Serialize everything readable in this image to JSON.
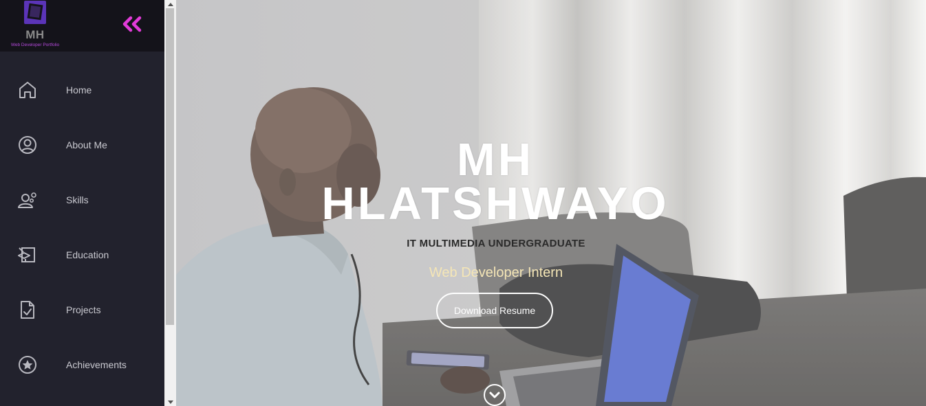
{
  "brand": {
    "initials": "MH",
    "tagline": "Web Developer Portfolio",
    "accent_color": "#e23bd9",
    "logo_color": "#6a3fd0"
  },
  "sidebar": {
    "collapse_icon": "double-chevron-left-icon",
    "items": [
      {
        "label": "Home",
        "icon": "home-icon"
      },
      {
        "label": "About Me",
        "icon": "user-circle-icon"
      },
      {
        "label": "Skills",
        "icon": "user-gear-icon"
      },
      {
        "label": "Education",
        "icon": "graduation-board-icon"
      },
      {
        "label": "Projects",
        "icon": "document-check-icon"
      },
      {
        "label": "Achievements",
        "icon": "star-circle-icon"
      }
    ]
  },
  "hero": {
    "name_line1": "MH",
    "name_line2": "HLATSHWAYO",
    "subtitle": "IT MULTIMEDIA UNDERGRADUATE",
    "role": "Web Developer Intern",
    "download_label": "Download Resume",
    "scroll_icon": "chevron-down-icon"
  }
}
